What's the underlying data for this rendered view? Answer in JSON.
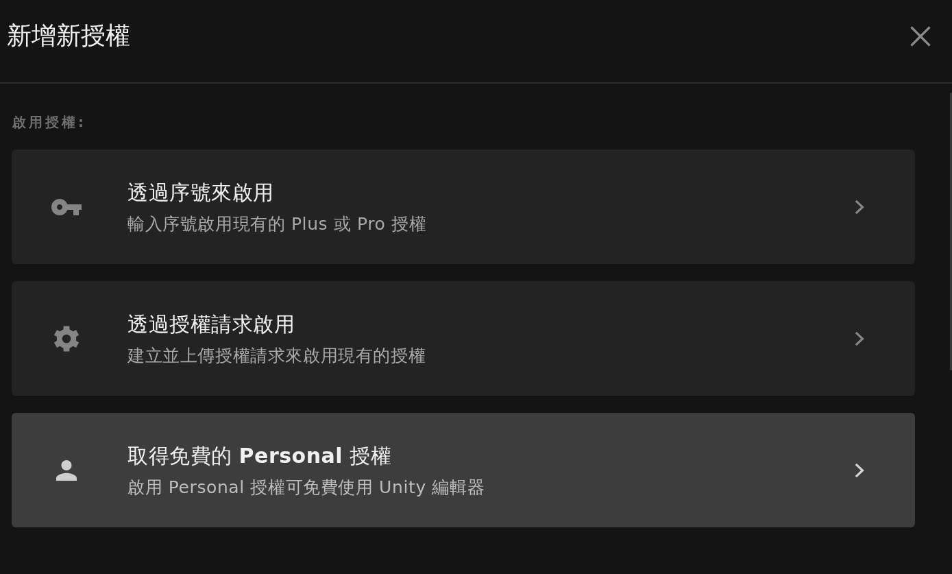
{
  "dialog": {
    "title": "新增新授權"
  },
  "section_label": "啟用授權:",
  "options": [
    {
      "title": "透過序號來啟用",
      "description": "輸入序號啟用現有的 Plus 或 Pro 授權",
      "selected": false
    },
    {
      "title": "透過授權請求啟用",
      "description": "建立並上傳授權請求來啟用現有的授權",
      "selected": false
    },
    {
      "title": "取得免費的 **Personal** 授權",
      "description": "啟用 Personal 授權可免費使用 Unity 編輯器",
      "selected": true
    }
  ]
}
